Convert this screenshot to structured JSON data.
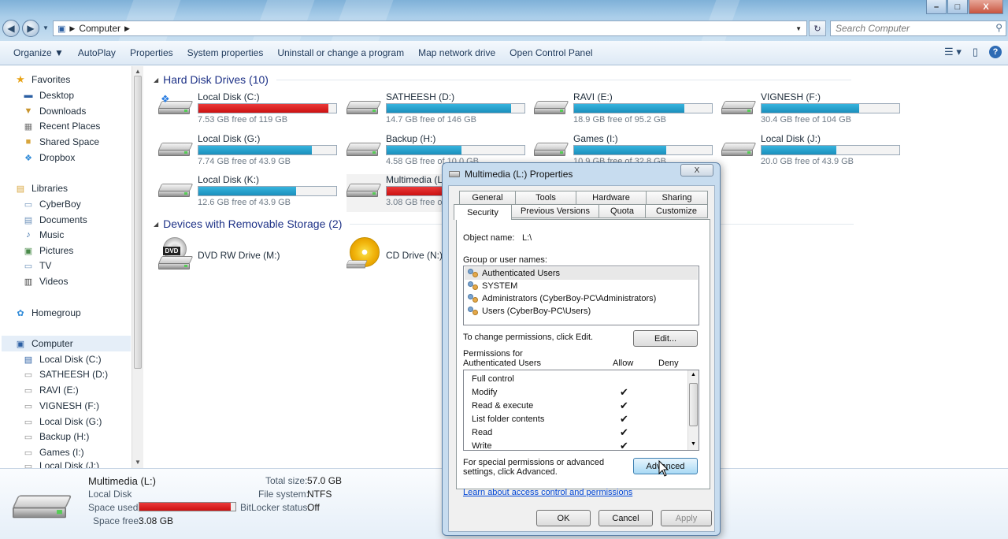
{
  "address": {
    "root_icon": "computer-icon",
    "path": [
      "Computer"
    ],
    "search_placeholder": "Search Computer"
  },
  "window_buttons": {
    "minimize": "–",
    "maximize": "□",
    "close": "X"
  },
  "toolbar": {
    "items": [
      "Organize ▼",
      "AutoPlay",
      "Properties",
      "System properties",
      "Uninstall or change a program",
      "Map network drive",
      "Open Control Panel"
    ]
  },
  "nav": {
    "favorites": {
      "label": "Favorites",
      "items": [
        "Desktop",
        "Downloads",
        "Recent Places",
        "Shared Space",
        "Dropbox"
      ]
    },
    "libraries": {
      "label": "Libraries",
      "items": [
        "CyberBoy",
        "Documents",
        "Music",
        "Pictures",
        "TV",
        "Videos"
      ]
    },
    "homegroup": "Homegroup",
    "computer": {
      "label": "Computer",
      "items": [
        "Local Disk (C:)",
        "SATHEESH (D:)",
        "RAVI (E:)",
        "VIGNESH (F:)",
        "Local Disk (G:)",
        "Backup (H:)",
        "Games (I:)",
        "Local Disk (J:)"
      ]
    }
  },
  "groups": {
    "hdd": "Hard Disk Drives (10)",
    "removable": "Devices with Removable Storage (2)"
  },
  "drives": [
    {
      "name": "Local Disk (C:)",
      "free": "7.53 GB free of 119 GB",
      "used": 0.94,
      "color": "#d61d1d"
    },
    {
      "name": "SATHEESH (D:)",
      "free": "14.7 GB free of 146 GB",
      "used": 0.9,
      "color": "#2aa3cf"
    },
    {
      "name": "RAVI (E:)",
      "free": "18.9 GB free of 95.2 GB",
      "used": 0.8,
      "color": "#2aa3cf"
    },
    {
      "name": "VIGNESH (F:)",
      "free": "30.4 GB free of 104 GB",
      "used": 0.71,
      "color": "#2aa3cf"
    },
    {
      "name": "Local Disk (G:)",
      "free": "7.74 GB free of 43.9 GB",
      "used": 0.82,
      "color": "#2aa3cf"
    },
    {
      "name": "Backup (H:)",
      "free": "4.58 GB free of 10.0 GB",
      "used": 0.54,
      "color": "#2aa3cf"
    },
    {
      "name": "Games (I:)",
      "free": "10.9 GB free of 32.8 GB",
      "used": 0.67,
      "color": "#2aa3cf"
    },
    {
      "name": "Local Disk (J:)",
      "free": "20.0 GB free of 43.9 GB",
      "used": 0.54,
      "color": "#2aa3cf"
    },
    {
      "name": "Local Disk (K:)",
      "free": "12.6 GB free of 43.9 GB",
      "used": 0.71,
      "color": "#2aa3cf"
    },
    {
      "name": "Multimedia (L:)",
      "free": "3.08 GB free of 57.0 GB",
      "used": 0.95,
      "color": "#d61d1d"
    }
  ],
  "removable": [
    {
      "name": "DVD RW Drive (M:)",
      "badge": "DVD"
    },
    {
      "name": "CD Drive (N:)"
    }
  ],
  "details": {
    "name": "Multimedia (L:)",
    "type": "Local Disk",
    "space_used_label": "Space used:",
    "space_used": 0.95,
    "space_free_label": "Space free:",
    "space_free": "3.08 GB",
    "total_label": "Total size:",
    "total": "57.0 GB",
    "fs_label": "File system:",
    "fs": "NTFS",
    "bitlocker_label": "BitLocker status:",
    "bitlocker": "Off"
  },
  "dialog": {
    "title": "Multimedia (L:) Properties",
    "close": "X",
    "tabs_back": [
      "General",
      "Tools",
      "Hardware",
      "Sharing"
    ],
    "tabs_front": [
      "Security",
      "Previous Versions",
      "Quota",
      "Customize"
    ],
    "object_label": "Object name:",
    "object_value": "L:\\",
    "group_label": "Group or user names:",
    "users": [
      "Authenticated Users",
      "SYSTEM",
      "Administrators (CyberBoy-PC\\Administrators)",
      "Users (CyberBoy-PC\\Users)"
    ],
    "change_text": "To change permissions, click Edit.",
    "edit": "Edit...",
    "perm_label": "Permissions for Authenticated Users",
    "allow": "Allow",
    "deny": "Deny",
    "permissions": [
      {
        "name": "Full control",
        "allow": false
      },
      {
        "name": "Modify",
        "allow": true
      },
      {
        "name": "Read & execute",
        "allow": true
      },
      {
        "name": "List folder contents",
        "allow": true
      },
      {
        "name": "Read",
        "allow": true
      },
      {
        "name": "Write",
        "allow": true
      }
    ],
    "special_text": "For special permissions or advanced settings, click Advanced.",
    "advanced": "Advanced",
    "link": "Learn about access control and permissions",
    "ok": "OK",
    "cancel": "Cancel",
    "apply": "Apply"
  }
}
